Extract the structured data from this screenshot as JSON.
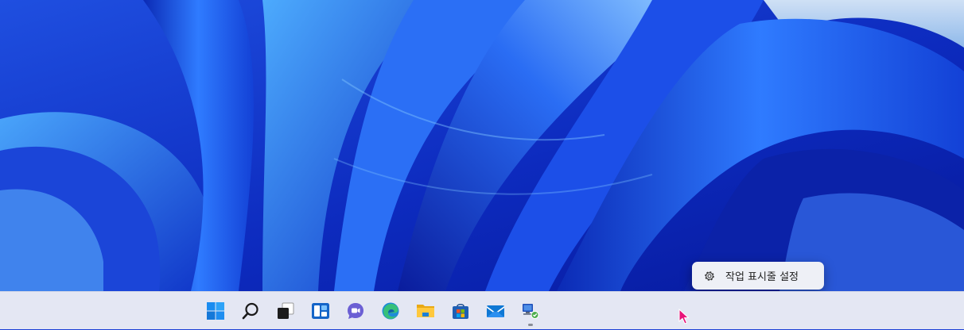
{
  "desktop": {
    "wallpaper": "windows-11-bloom",
    "colors": {
      "deep_blue": "#0a1fa8",
      "mid_blue": "#1c4fe8",
      "light_blue": "#4aa8ff",
      "sky": "#b9d4f2"
    }
  },
  "context_menu": {
    "icon": "gear-icon",
    "label": "작업 표시줄 설정"
  },
  "taskbar": {
    "background": "#e4e7f3",
    "items": [
      {
        "name": "start",
        "icon": "windows-logo-icon"
      },
      {
        "name": "search",
        "icon": "search-icon"
      },
      {
        "name": "task-view",
        "icon": "task-view-icon"
      },
      {
        "name": "widgets",
        "icon": "widgets-icon"
      },
      {
        "name": "chat",
        "icon": "teams-chat-icon"
      },
      {
        "name": "edge",
        "icon": "edge-icon"
      },
      {
        "name": "file-explorer",
        "icon": "folder-icon"
      },
      {
        "name": "microsoft-store",
        "icon": "store-icon"
      },
      {
        "name": "mail",
        "icon": "mail-icon"
      },
      {
        "name": "network-app",
        "icon": "network-computer-icon",
        "running": true
      }
    ]
  },
  "cursor": {
    "icon": "mouse-pointer-icon",
    "color": "#e8147a"
  }
}
